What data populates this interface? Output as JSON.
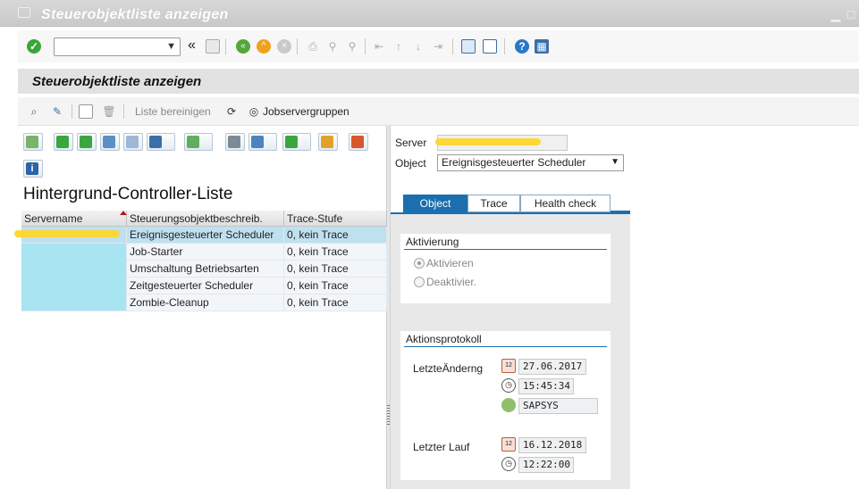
{
  "window": {
    "title": "Steuerobjektliste anzeigen"
  },
  "systoolbar": {
    "back_label": "«"
  },
  "heading": {
    "title": "Steuerobjektliste anzeigen"
  },
  "apptoolbar": {
    "clear_list_label": "Liste bereinigen",
    "jobserver_groups_label": "Jobservergruppen"
  },
  "list": {
    "title": "Hintergrund-Controller-Liste",
    "columns": [
      "Servername",
      "Steuerungsobjektbeschreib.",
      "Trace-Stufe"
    ],
    "rows": [
      {
        "description": "Ereignisgesteuerter Scheduler",
        "trace": "0, kein Trace"
      },
      {
        "description": "Job-Starter",
        "trace": "0, kein Trace"
      },
      {
        "description": "Umschaltung Betriebsarten",
        "trace": "0, kein Trace"
      },
      {
        "description": "Zeitgesteuerter Scheduler",
        "trace": "0, kein Trace"
      },
      {
        "description": "Zombie-Cleanup",
        "trace": "0, kein Trace"
      }
    ]
  },
  "detail": {
    "server_label": "Server",
    "object_label": "Object",
    "object_value": "Ereignisgesteuerter Scheduler",
    "tabs": [
      "Object",
      "Trace",
      "Health check"
    ],
    "activation": {
      "title": "Aktivierung",
      "activate": "Aktivieren",
      "deactivate": "Deaktivier."
    },
    "log": {
      "title": "Aktionsprotokoll",
      "last_change_label": "LetzteÄnderng",
      "last_change_date": "27.06.2017",
      "last_change_time": "15:45:34",
      "last_change_user": "SAPSYS",
      "last_run_label": "Letzter Lauf",
      "last_run_date": "16.12.2018",
      "last_run_time": "12:22:00"
    }
  },
  "colors": {
    "accent": "#1b6fae",
    "selected_row": "#bfe1ef",
    "servername_cell": "#a8e4f2",
    "redaction": "#ffd62a"
  }
}
